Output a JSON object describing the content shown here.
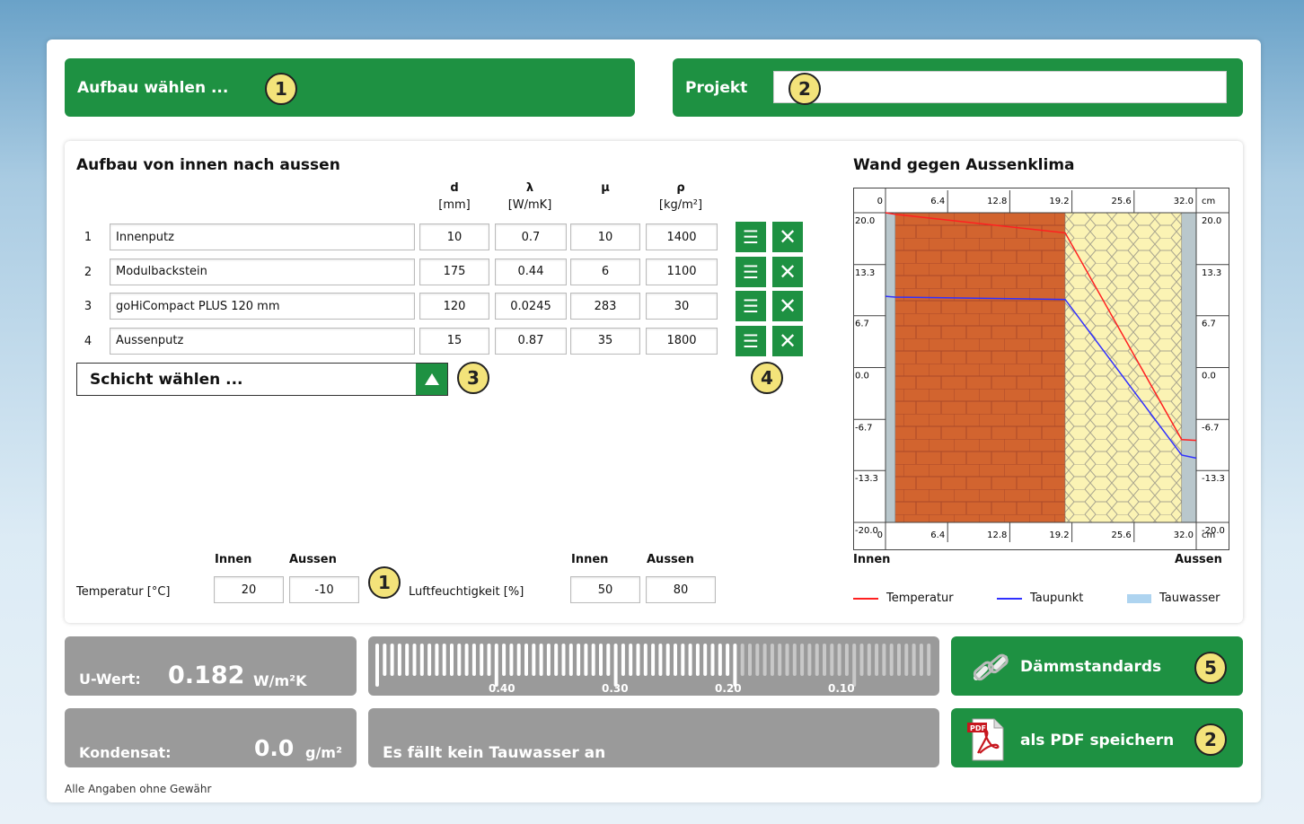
{
  "top": {
    "aufbau_label": "Aufbau wählen ...",
    "projekt_label": "Projekt",
    "projekt_value": "",
    "badge1": "1",
    "badge2": "2"
  },
  "table": {
    "title": "Aufbau von innen nach aussen",
    "headers": [
      {
        "sym": "d",
        "unit": "[mm]"
      },
      {
        "sym": "λ",
        "unit": "[W/mK]"
      },
      {
        "sym": "μ",
        "unit": ""
      },
      {
        "sym": "ρ",
        "unit": "[kg/m²]"
      }
    ],
    "rows": [
      {
        "n": "1",
        "name": "Innenputz",
        "d": "10",
        "lambda": "0.7",
        "mu": "10",
        "rho": "1400"
      },
      {
        "n": "2",
        "name": "Modulbackstein",
        "d": "175",
        "lambda": "0.44",
        "mu": "6",
        "rho": "1100"
      },
      {
        "n": "3",
        "name": "goHiCompact PLUS 120 mm",
        "d": "120",
        "lambda": "0.0245",
        "mu": "283",
        "rho": "30"
      },
      {
        "n": "4",
        "name": "Aussenputz",
        "d": "15",
        "lambda": "0.87",
        "mu": "35",
        "rho": "1800"
      }
    ],
    "schicht_label": "Schicht wählen ...",
    "badge3": "3",
    "badge4": "4"
  },
  "climate": {
    "innen": "Innen",
    "aussen": "Aussen",
    "badge": "1",
    "temp_label": "Temperatur [°C]",
    "temp_innen": "20",
    "temp_aussen": "-10",
    "hum_label": "Luftfeuchtigkeit [%]",
    "hum_innen": "50",
    "hum_aussen": "80"
  },
  "chart_data": {
    "type": "line",
    "title": "Wand gegen Aussenklima",
    "x_ticks": [
      "0",
      "6.4",
      "12.8",
      "19.2",
      "25.6",
      "32.0"
    ],
    "x_unit": "cm",
    "y_ticks": [
      "20.0",
      "13.3",
      "6.7",
      "0.0",
      "-6.7",
      "-13.3",
      "-20.0"
    ],
    "ylim": [
      -20,
      20
    ],
    "xlim": [
      0,
      32
    ],
    "xlabel_left": "Innen",
    "xlabel_right": "Aussen",
    "layers": [
      {
        "name": "Innenputz",
        "from": 0,
        "to": 1
      },
      {
        "name": "Modulbackstein",
        "from": 1,
        "to": 18.5
      },
      {
        "name": "goHiCompact PLUS 120 mm",
        "from": 18.5,
        "to": 30.5
      },
      {
        "name": "Aussenputz",
        "from": 30.5,
        "to": 32
      }
    ],
    "series": [
      {
        "name": "Temperatur",
        "color": "#ff2020",
        "x": [
          0,
          1,
          18.5,
          30.5,
          32
        ],
        "y": [
          20,
          19.8,
          17.4,
          -9.3,
          -9.4
        ]
      },
      {
        "name": "Taupunkt",
        "color": "#3030ff",
        "x": [
          0,
          1,
          18.5,
          30.5,
          32
        ],
        "y": [
          9.2,
          9.1,
          8.8,
          -11.3,
          -11.7
        ]
      }
    ],
    "legend": [
      {
        "name": "Temperatur",
        "color": "#ff2020"
      },
      {
        "name": "Taupunkt",
        "color": "#3030ff"
      },
      {
        "name": "Tauwasser",
        "color": "#aed4f0"
      }
    ]
  },
  "results": {
    "uwert_label": "U-Wert:",
    "uwert_value": "0.182",
    "uwert_unit": "W/m²K",
    "uwert_number": 0.182,
    "scale_ticks": [
      "0.40",
      "0.30",
      "0.20",
      "0.10"
    ],
    "kondensat_label": "Kondensat:",
    "kondensat_value": "0.0",
    "kondensat_unit": "g/m²",
    "message": "Es fällt kein Tauwasser an",
    "daemm_label": "Dämmstandards",
    "pdf_label": "als PDF speichern",
    "badge5": "5",
    "badge2": "2",
    "disclaimer": "Alle Angaben ohne Gewähr"
  }
}
